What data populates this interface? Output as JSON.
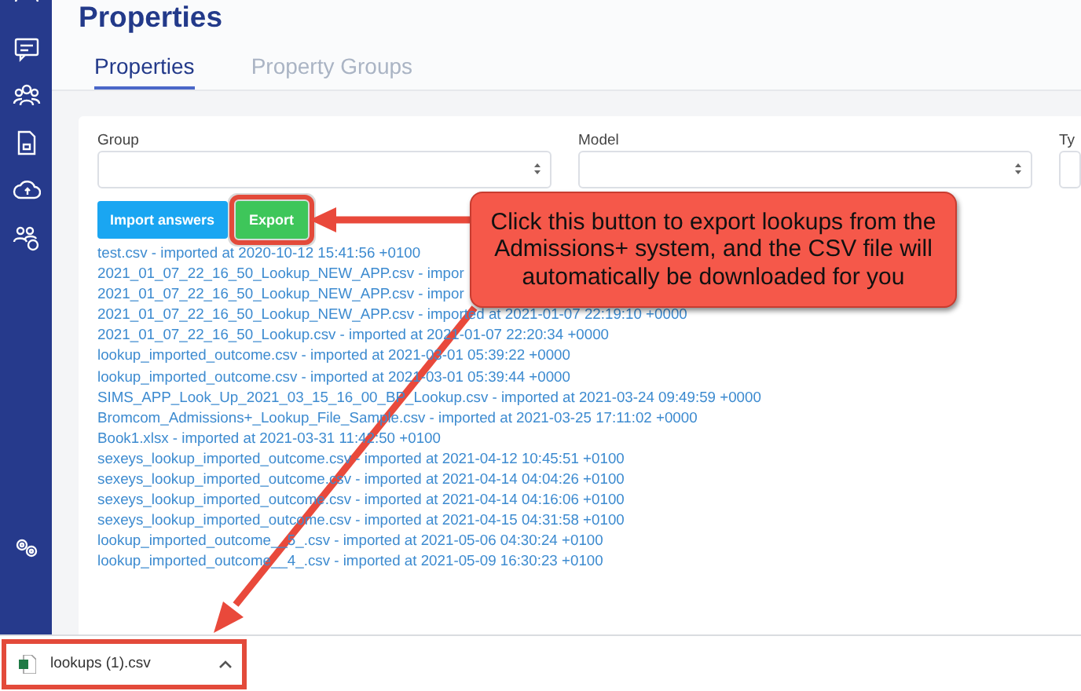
{
  "page": {
    "title": "Properties"
  },
  "tabs": [
    {
      "label": "Properties",
      "selected": true
    },
    {
      "label": "Property Groups",
      "selected": false
    }
  ],
  "filters": [
    {
      "label": "Group"
    },
    {
      "label": "Model"
    },
    {
      "label": "Ty"
    }
  ],
  "buttons": [
    {
      "label": "Import answers",
      "kind": "primary",
      "highlighted": false
    },
    {
      "label": "Export",
      "kind": "success",
      "highlighted": true
    }
  ],
  "imports": [
    "test.csv - imported at 2020-10-12 15:41:56 +0100",
    "2021_01_07_22_16_50_Lookup_NEW_APP.csv - impor",
    "2021_01_07_22_16_50_Lookup_NEW_APP.csv - impor",
    "2021_01_07_22_16_50_Lookup_NEW_APP.csv - imported at 2021-01-07 22:19:10 +0000",
    "2021_01_07_22_16_50_Lookup.csv - imported at 2021-01-07 22:20:34 +0000",
    "lookup_imported_outcome.csv - imported at 2021-03-01 05:39:22 +0000",
    "lookup_imported_outcome.csv - imported at 2021-03-01 05:39:44 +0000",
    "SIMS_APP_Look_Up_2021_03_15_16_00_BP_Lookup.csv - imported at 2021-03-24 09:49:59 +0000",
    "Bromcom_Admissions+_Lookup_File_Sample.csv - imported at 2021-03-25 17:11:02 +0000",
    "Book1.xlsx - imported at 2021-03-31 11:42:50 +0100",
    "sexeys_lookup_imported_outcome.csv - imported at 2021-04-12 10:45:51 +0100",
    "sexeys_lookup_imported_outcome.csv - imported at 2021-04-14 04:04:26 +0100",
    "sexeys_lookup_imported_outcome.csv - imported at 2021-04-14 04:16:06 +0100",
    "sexeys_lookup_imported_outcome.csv - imported at 2021-04-15 04:31:58 +0100",
    "lookup_imported_outcome__5_.csv - imported at 2021-05-06 04:30:24 +0100",
    "lookup_imported_outcome__4_.csv - imported at 2021-05-09 16:30:23 +0100"
  ],
  "callout": {
    "text": "Click this button to export lookups from the Admissions+ system, and the CSV file will automatically be downloaded for you"
  },
  "download": {
    "filename": "lookups (1).csv",
    "highlighted": true
  }
}
